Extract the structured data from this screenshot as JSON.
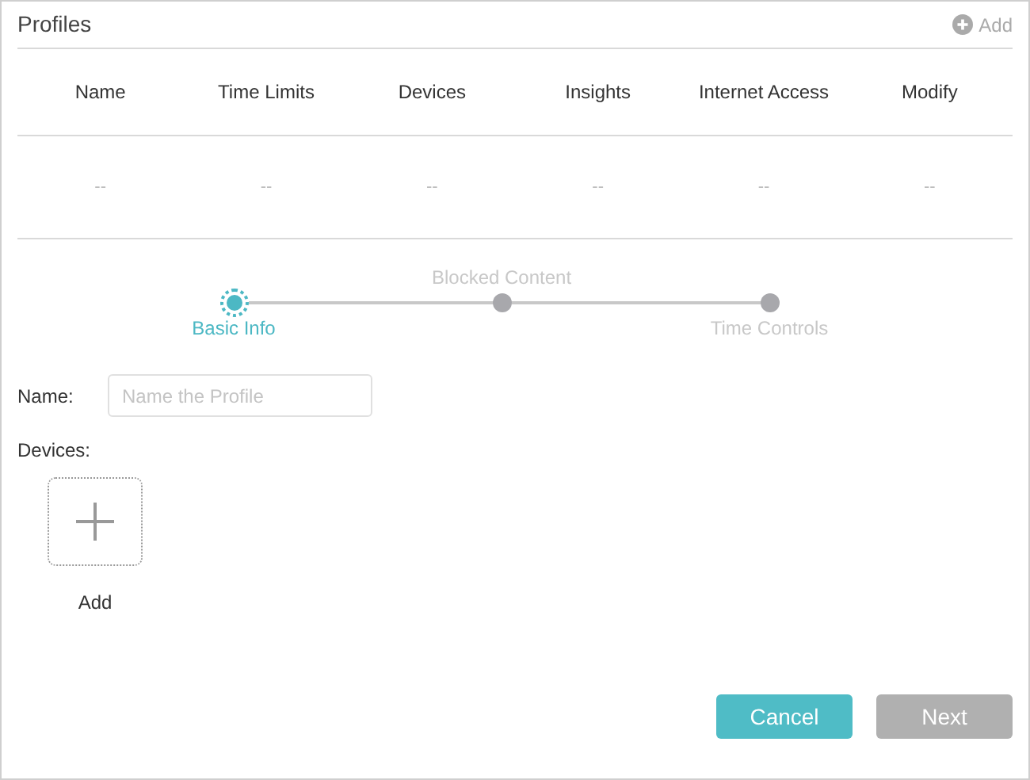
{
  "title": "Profiles",
  "add_link": "Add",
  "table": {
    "columns": [
      "Name",
      "Time Limits",
      "Devices",
      "Insights",
      "Internet Access",
      "Modify"
    ],
    "rows": [
      [
        "--",
        "--",
        "--",
        "--",
        "--",
        "--"
      ]
    ]
  },
  "steps": [
    {
      "label": "Basic Info",
      "selected": true
    },
    {
      "label": "Blocked Content",
      "selected": false
    },
    {
      "label": "Time Controls",
      "selected": false
    }
  ],
  "name_field": {
    "label": "Name:",
    "placeholder": "Name the Profile"
  },
  "devices": {
    "label": "Devices:",
    "add_label": "Add"
  },
  "buttons": [
    {
      "label": "Cancel",
      "kind": "primary"
    },
    {
      "label": "Next",
      "kind": "disabled"
    }
  ]
}
